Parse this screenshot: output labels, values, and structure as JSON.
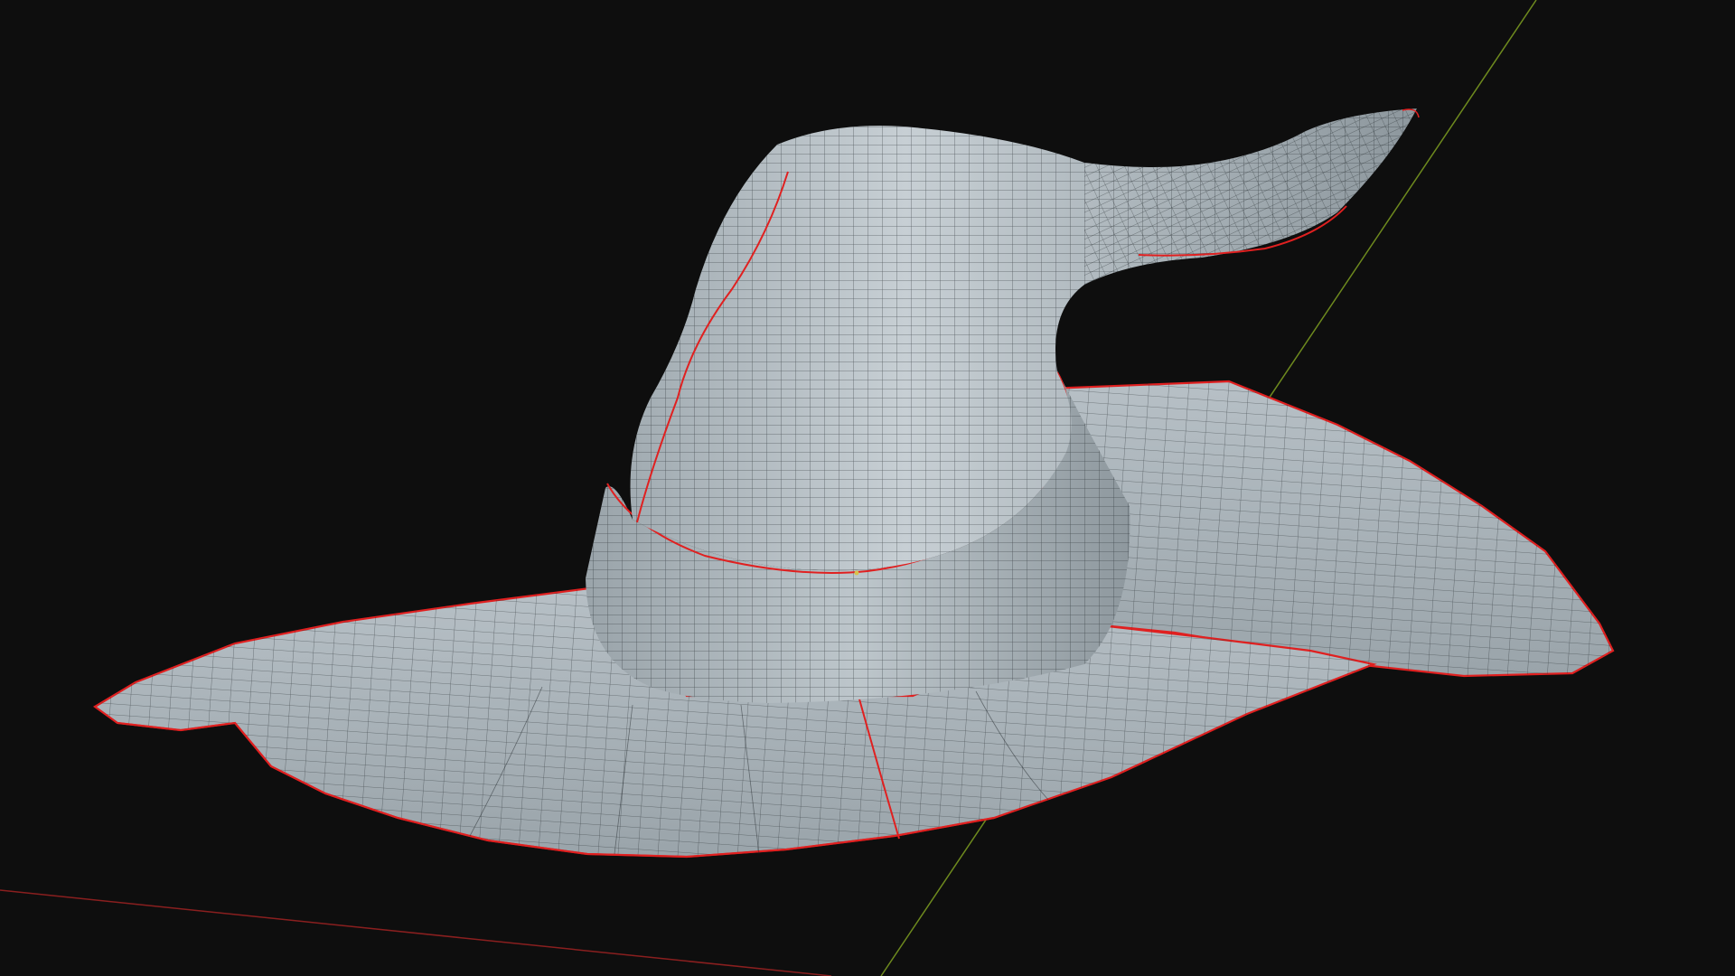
{
  "viewport": {
    "background": "#0e0e0e",
    "mesh_object": "witch-hat",
    "shading": "solid",
    "overlay": "wireframe",
    "seam_color": "#e02020",
    "x_axis_color": "#8a1f1f",
    "y_axis_color": "#6e8a1e",
    "mesh_fill": "#a9b2b8",
    "wire_color": "#1e2428"
  }
}
